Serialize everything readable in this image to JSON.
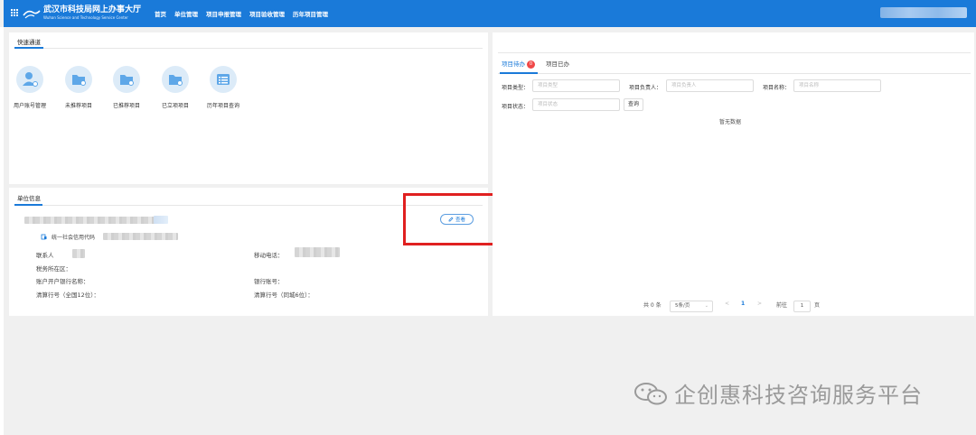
{
  "header": {
    "brand_cn": "武汉市科技局网上办事大厅",
    "brand_en": "Wuhan Science and Technology Service Center",
    "nav": [
      "首页",
      "单位管理",
      "项目申报管理",
      "项目验收管理",
      "历年项目管理"
    ]
  },
  "quick_access": {
    "title": "快速通道",
    "items": [
      {
        "label": "用户账号管理",
        "icon": "user-icon"
      },
      {
        "label": "未推荐项目",
        "icon": "folder-icon"
      },
      {
        "label": "已推荐项目",
        "icon": "folder-icon"
      },
      {
        "label": "已立项项目",
        "icon": "folder-icon"
      },
      {
        "label": "历年项目查询",
        "icon": "list-icon"
      }
    ]
  },
  "unit_info": {
    "title": "单位信息",
    "view_label": "查看",
    "credit_code_label": "统一社会信用代码",
    "contact_label": "联系人",
    "mobile_label": "移动电话：",
    "tax_label": "税务所在区：",
    "bank_name_label": "账户开户银行名称：",
    "bank_account_label": "银行账号：",
    "clearing_full_label": "清算行号（全国12位）：",
    "clearing_city_label": "清算行号（同城6位）："
  },
  "projects": {
    "tab_pending": "项目待办",
    "pending_count": "0",
    "tab_done": "项目已办",
    "filters": {
      "type_label": "项目类型：",
      "type_placeholder": "项目类型",
      "owner_label": "项目负责人：",
      "owner_placeholder": "项目负责人",
      "name_label": "项目名称：",
      "name_placeholder": "项目名称",
      "status_label": "项目状态：",
      "status_placeholder": "项目状态",
      "query_label": "查询"
    },
    "empty_text": "暂无数据",
    "pagination": {
      "total": "共 0 条",
      "page_size": "5条/页",
      "prev": "<",
      "current_page": "1",
      "next": ">",
      "goto_label": "前往",
      "goto_value": "1",
      "page_suffix": "页"
    }
  },
  "watermark": {
    "text": "企创惠科技咨询服务平台"
  },
  "colors": {
    "primary": "#1a7ad9",
    "highlight": "#e02020",
    "badge": "#f04848"
  }
}
